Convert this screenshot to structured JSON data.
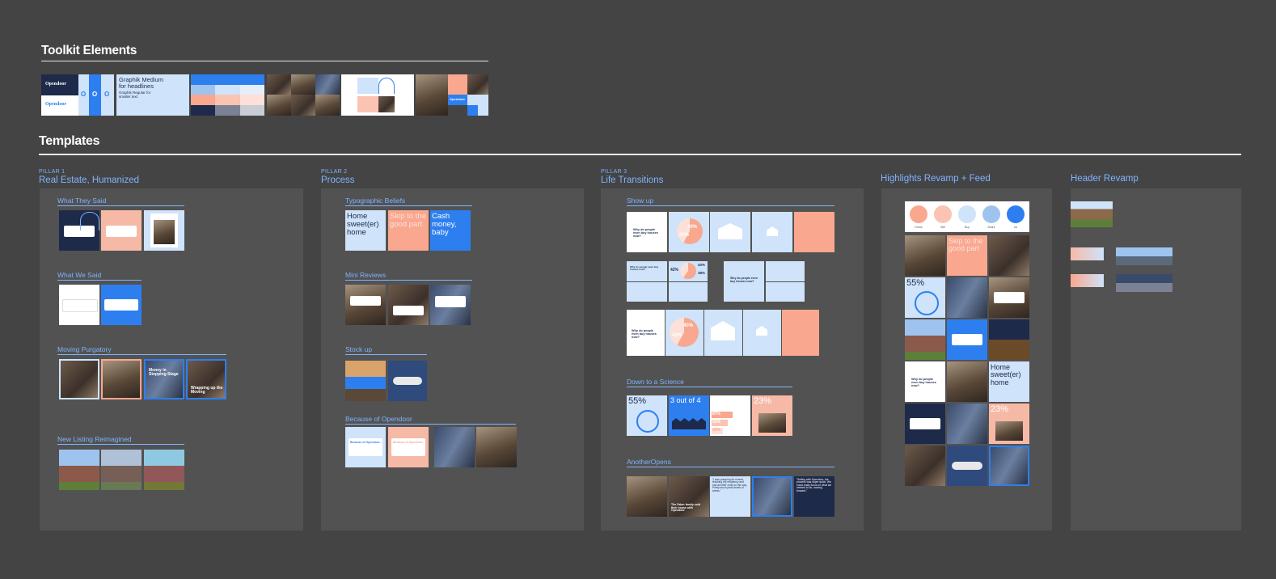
{
  "header": {
    "toolkit_title": "Toolkit Elements",
    "templates_title": "Templates"
  },
  "toolkit": {
    "logo_dark": "Opendoor",
    "logo_light": "Opendoor",
    "type_headline": "Graphik Medium for headlines",
    "type_body": "Graphik Regular for smaller text",
    "brand_word": "Opendoor"
  },
  "pillars": [
    {
      "kicker": "PILLAR 1",
      "title": "Real Estate, Humanized"
    },
    {
      "kicker": "PILLAR 2",
      "title": "Process"
    },
    {
      "kicker": "PILLAR 3",
      "title": "Life Transitions"
    }
  ],
  "columns": {
    "highlights": "Highlights Revamp + Feed",
    "header_revamp": "Header Revamp"
  },
  "sections": {
    "p1": [
      "What They Said",
      "What We Said",
      "Moving Purgatory",
      "New Listing Reimagined"
    ],
    "p2": [
      "Typographic Beliefs",
      "Mini Reviews",
      "Stock up",
      "Because of Opendoor"
    ],
    "p3": [
      "Show up",
      "Down to a Science",
      "AnotherOpens"
    ]
  },
  "cards": {
    "home_sweet": "Home sweet(er) home",
    "skip_good": "Skip to the good part",
    "cash_money": "Cash money, baby",
    "pct_55": "55%",
    "three_of_four": "3 out of 4",
    "pct_23": "23%",
    "pct_40": "40%",
    "pct_42": "42%",
    "pct_38": "38%",
    "pct_87": "87%",
    "pct_50": "50%",
    "pct_25": "25%",
    "why_q": "Why do people even buy houses now?",
    "because_of": "Because of Opendoor...",
    "quote_1": "\"I was prepping for exams, finishing my residency and had another child on the way. Pretty much peak levels of stress.\"",
    "quote_2": "\"Selling with Opendoor, the process was super quick. We could really focus on what we needed to do, moving forward.\"",
    "family_caption": "The Faber family sold their house with Opendoor",
    "money_slide": "Money in Stopping Stage",
    "moving_slide": "Wrapping up the Moving"
  },
  "highlights_icons": [
    "Home",
    "Sell",
    "Buy",
    "Share",
    "Us"
  ]
}
